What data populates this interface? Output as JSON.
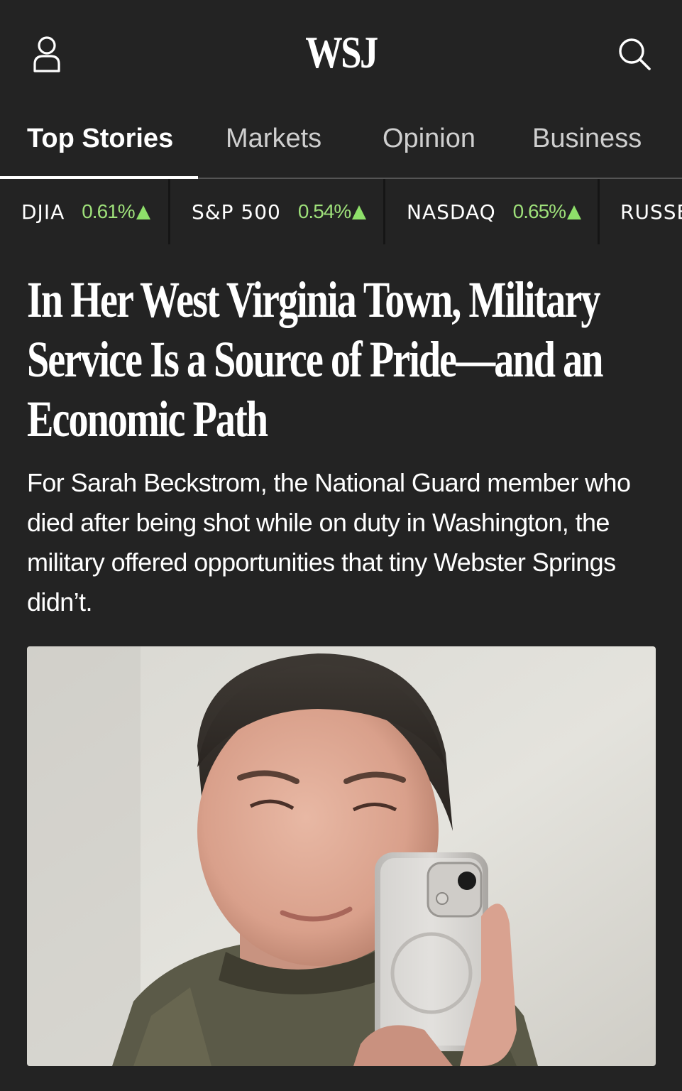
{
  "header": {
    "logo": "WSJ",
    "user_icon": "user-icon",
    "search_icon": "search-icon"
  },
  "tabs": [
    {
      "label": "Top Stories",
      "active": true
    },
    {
      "label": "Markets",
      "active": false
    },
    {
      "label": "Opinion",
      "active": false
    },
    {
      "label": "Business",
      "active": false
    }
  ],
  "ticker": [
    {
      "name": "DJIA",
      "change": "0.61%",
      "direction": "up"
    },
    {
      "name": "S&P 500",
      "change": "0.54%",
      "direction": "up"
    },
    {
      "name": "NASDAQ",
      "change": "0.65%",
      "direction": "up"
    },
    {
      "name": "RUSSE",
      "change": "",
      "direction": ""
    }
  ],
  "article": {
    "headline": "In Her West Virginia Town, Military Service Is a Source of Pride—and an Economic Path",
    "summary": "For Sarah Beckstrom, the National Guard member who died after being shot while on duty in Washington, the military offered opportunities that tiny Webster Springs didn’t."
  },
  "colors": {
    "background": "#232323",
    "positive": "#9ee07a",
    "text": "#ffffff",
    "tab_inactive": "#cfcfcf"
  }
}
